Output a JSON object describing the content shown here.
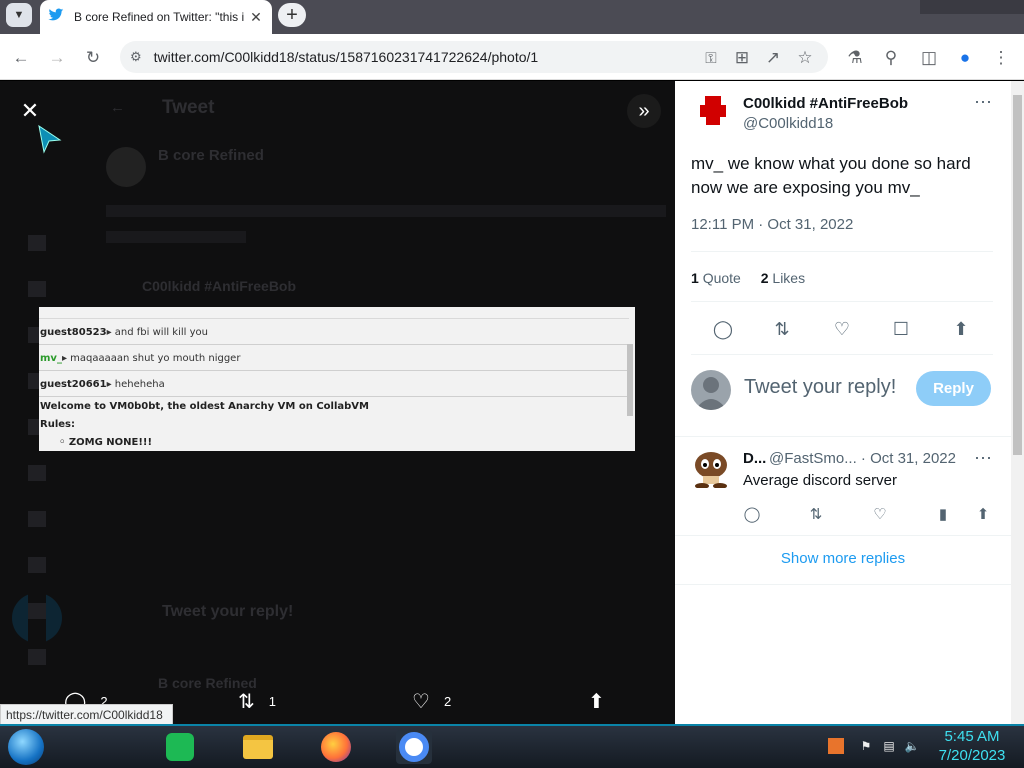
{
  "browser": {
    "tab_title": "B core Refined on Twitter: \"this i",
    "url": "twitter.com/C00lkidd18/status/1587160231741722624/photo/1",
    "status_url": "https://twitter.com/C00lkidd18"
  },
  "background": {
    "header_title": "Tweet",
    "author_name": "B core Refined",
    "quoted_author": "C00lkidd #AntiFreeBob",
    "reply_placeholder": "Tweet your reply!",
    "reply_author": "B core Refined"
  },
  "photo": {
    "lines": [
      {
        "user": "guest80523",
        "text": "and fbi will kill you"
      },
      {
        "user": "mv_",
        "text": "maqaaaaan shut yo mouth nigger"
      },
      {
        "user": "guest20661",
        "text": "heheheha"
      }
    ],
    "welcome": "Welcome to VM0b0bt, the oldest Anarchy VM on CollabVM",
    "rules_label": "Rules:",
    "rule_item": "ZOMG NONE!!!"
  },
  "viewer_actions": {
    "replies": "2",
    "retweets": "1",
    "likes": "2"
  },
  "tweet": {
    "author_name": "C00lkidd #AntiFreeBob",
    "author_handle": "@C00lkidd18",
    "text": "mv_ we know what you done so hard now we are exposing you mv_",
    "timestamp": "12:11 PM · Oct 31, 2022",
    "quote_count": "1",
    "quote_label": "Quote",
    "like_count": "2",
    "like_label": "Likes"
  },
  "reply_box": {
    "placeholder": "Tweet your reply!",
    "button": "Reply"
  },
  "reply": {
    "name": "D...",
    "handle_date": "@FastSmo... · Oct 31, 2022",
    "text": "Average discord server"
  },
  "show_more": "Show more replies",
  "taskbar": {
    "time": "5:45 AM",
    "date": "7/20/2023"
  },
  "colors": {
    "twitter_blue": "#1d9bf0",
    "reply_button_disabled": "#8ecdf8",
    "clock": "#3ee0f0",
    "chat_green": "#2a9a2a"
  }
}
